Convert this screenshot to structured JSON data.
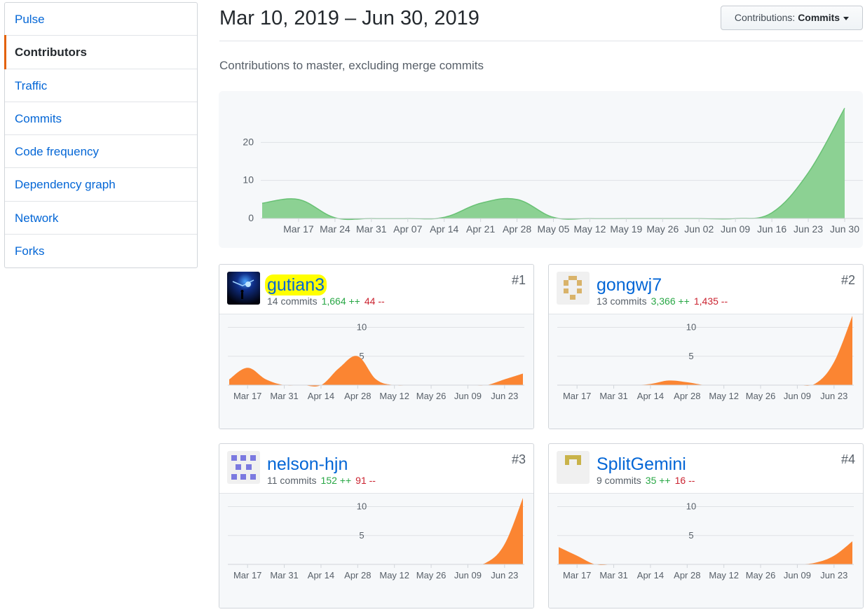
{
  "sidebar": {
    "items": [
      {
        "label": "Pulse",
        "selected": false
      },
      {
        "label": "Contributors",
        "selected": true
      },
      {
        "label": "Traffic",
        "selected": false
      },
      {
        "label": "Commits",
        "selected": false
      },
      {
        "label": "Code frequency",
        "selected": false
      },
      {
        "label": "Dependency graph",
        "selected": false
      },
      {
        "label": "Network",
        "selected": false
      },
      {
        "label": "Forks",
        "selected": false
      }
    ]
  },
  "header": {
    "range_title": "Mar 10, 2019 – Jun 30, 2019",
    "dropdown_prefix": "Contributions: ",
    "dropdown_value": "Commits",
    "subtitle": "Contributions to master, excluding merge commits"
  },
  "colors": {
    "link": "#0366d6",
    "main_area": "#8cd193",
    "main_line": "#68c174",
    "contrib_area": "#fb8532",
    "additions": "#28a745",
    "deletions": "#cb2431",
    "selected_tab_accent": "#e36209",
    "highlight": "#ffff00"
  },
  "chart_data": [
    {
      "type": "area",
      "title": "",
      "x": [
        "Mar 10",
        "Mar 17",
        "Mar 24",
        "Mar 31",
        "Apr 07",
        "Apr 14",
        "Apr 21",
        "Apr 28",
        "May 05",
        "May 12",
        "May 19",
        "May 26",
        "Jun 02",
        "Jun 09",
        "Jun 16",
        "Jun 23",
        "Jun 30"
      ],
      "tick_labels": [
        "Mar 17",
        "Mar 24",
        "Mar 31",
        "Apr 07",
        "Apr 14",
        "Apr 21",
        "Apr 28",
        "May 05",
        "May 12",
        "May 19",
        "May 26",
        "Jun 02",
        "Jun 09",
        "Jun 16",
        "Jun 23",
        "Jun 30"
      ],
      "series": [
        {
          "values": [
            4,
            5,
            0.2,
            0,
            0,
            0.3,
            4,
            5,
            0.3,
            0,
            0,
            0,
            0,
            0,
            1.5,
            12,
            29
          ]
        }
      ],
      "yticks": [
        0,
        10,
        20
      ],
      "ylim": [
        0,
        30
      ],
      "grid": true
    },
    {
      "type": "area",
      "title": "gutian3",
      "x": [
        "Mar 10",
        "Mar 17",
        "Mar 24",
        "Mar 31",
        "Apr 07",
        "Apr 14",
        "Apr 21",
        "Apr 28",
        "May 05",
        "May 12",
        "May 19",
        "May 26",
        "Jun 02",
        "Jun 09",
        "Jun 16",
        "Jun 23",
        "Jun 30"
      ],
      "tick_labels": [
        "Mar 17",
        "Mar 31",
        "Apr 14",
        "Apr 28",
        "May 12",
        "May 26",
        "Jun 09",
        "Jun 23"
      ],
      "series": [
        {
          "values": [
            1,
            3,
            1,
            0,
            0,
            0,
            3,
            5,
            1,
            0,
            0,
            0,
            0,
            0,
            0,
            1,
            2
          ]
        }
      ],
      "yticks": [
        5,
        10
      ],
      "ylim": [
        0,
        12
      ],
      "grid": true
    },
    {
      "type": "area",
      "title": "gongwj7",
      "x": [
        "Mar 10",
        "Mar 17",
        "Mar 24",
        "Mar 31",
        "Apr 07",
        "Apr 14",
        "Apr 21",
        "Apr 28",
        "May 05",
        "May 12",
        "May 19",
        "May 26",
        "Jun 02",
        "Jun 09",
        "Jun 16",
        "Jun 23",
        "Jun 30"
      ],
      "tick_labels": [
        "Mar 17",
        "Mar 31",
        "Apr 14",
        "Apr 28",
        "May 12",
        "May 26",
        "Jun 09",
        "Jun 23"
      ],
      "series": [
        {
          "values": [
            0,
            0,
            0,
            0,
            0,
            0.2,
            0.8,
            0.5,
            0,
            0,
            0,
            0,
            0,
            0,
            0.3,
            4,
            12.5
          ]
        }
      ],
      "yticks": [
        5,
        10
      ],
      "ylim": [
        0,
        12
      ],
      "grid": true
    },
    {
      "type": "area",
      "title": "nelson-hjn",
      "x": [
        "Mar 10",
        "Mar 17",
        "Mar 24",
        "Mar 31",
        "Apr 07",
        "Apr 14",
        "Apr 21",
        "Apr 28",
        "May 05",
        "May 12",
        "May 19",
        "May 26",
        "Jun 02",
        "Jun 09",
        "Jun 16",
        "Jun 23",
        "Jun 30"
      ],
      "tick_labels": [
        "Mar 17",
        "Mar 31",
        "Apr 14",
        "Apr 28",
        "May 12",
        "May 26",
        "Jun 09",
        "Jun 23"
      ],
      "series": [
        {
          "values": [
            0,
            0,
            0,
            0,
            0,
            0,
            0,
            0,
            0,
            0,
            0,
            0,
            0,
            0,
            0.3,
            3.5,
            11.5
          ]
        }
      ],
      "yticks": [
        5,
        10
      ],
      "ylim": [
        0,
        12
      ],
      "grid": true
    },
    {
      "type": "area",
      "title": "SplitGemini",
      "x": [
        "Mar 10",
        "Mar 17",
        "Mar 24",
        "Mar 31",
        "Apr 07",
        "Apr 14",
        "Apr 21",
        "Apr 28",
        "May 05",
        "May 12",
        "May 19",
        "May 26",
        "Jun 02",
        "Jun 09",
        "Jun 16",
        "Jun 23",
        "Jun 30"
      ],
      "tick_labels": [
        "Mar 17",
        "Mar 31",
        "Apr 14",
        "Apr 28",
        "May 12",
        "May 26",
        "Jun 09",
        "Jun 23"
      ],
      "series": [
        {
          "values": [
            3,
            1.5,
            0,
            0,
            0,
            0,
            0,
            0,
            0,
            0,
            0,
            0,
            0,
            0,
            0.3,
            1.5,
            4
          ]
        }
      ],
      "yticks": [
        5,
        10
      ],
      "ylim": [
        0,
        12
      ],
      "grid": true
    }
  ],
  "contributors": [
    {
      "login": "gutian3",
      "rank": "#1",
      "commits": "14 commits",
      "additions": "1,664 ++",
      "deletions": "44 --",
      "avatar_icon": "galaxy-photo-avatar-icon",
      "highlighted": true
    },
    {
      "login": "gongwj7",
      "rank": "#2",
      "commits": "13 commits",
      "additions": "3,366 ++",
      "deletions": "1,435 --",
      "avatar_icon": "identicon-avatar-icon",
      "avatar_color": "#d9b36a"
    },
    {
      "login": "nelson-hjn",
      "rank": "#3",
      "commits": "11 commits",
      "additions": "152 ++",
      "deletions": "91 --",
      "avatar_icon": "identicon-avatar-icon",
      "avatar_color": "#7b79e0"
    },
    {
      "login": "SplitGemini",
      "rank": "#4",
      "commits": "9 commits",
      "additions": "35 ++",
      "deletions": "16 --",
      "avatar_icon": "identicon-avatar-icon",
      "avatar_color": "#c9b34a"
    }
  ]
}
